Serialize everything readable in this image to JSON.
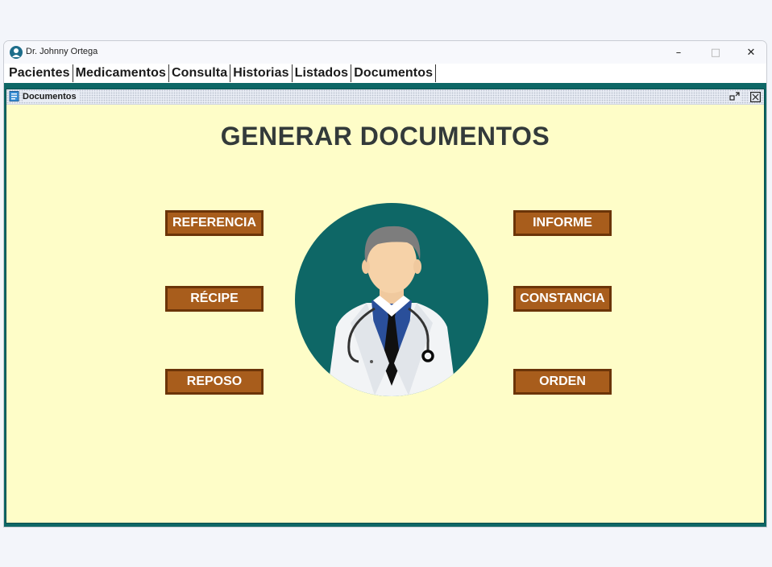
{
  "window": {
    "title": "Dr. Johnny Ortega",
    "controls": {
      "minimize": "–",
      "maximize": "□",
      "close": "✕"
    }
  },
  "menu": {
    "items": [
      {
        "label": "Pacientes"
      },
      {
        "label": "Medicamentos"
      },
      {
        "label": "Consulta"
      },
      {
        "label": "Historias"
      },
      {
        "label": "Listados"
      },
      {
        "label": "Documentos"
      }
    ]
  },
  "child_window": {
    "title": "Documentos"
  },
  "page": {
    "heading": "GENERAR DOCUMENTOS"
  },
  "buttons": {
    "referencia": "REFERENCIA",
    "recipe": "RÉCIPE",
    "reposo": "REPOSO",
    "informe": "INFORME",
    "constancia": "CONSTANCIA",
    "orden": "ORDEN"
  },
  "colors": {
    "background": "#fefdc8",
    "mdi": "#0e6766",
    "button": "#a85d1c",
    "button_border": "#6b3408",
    "circle": "#0e6766"
  }
}
